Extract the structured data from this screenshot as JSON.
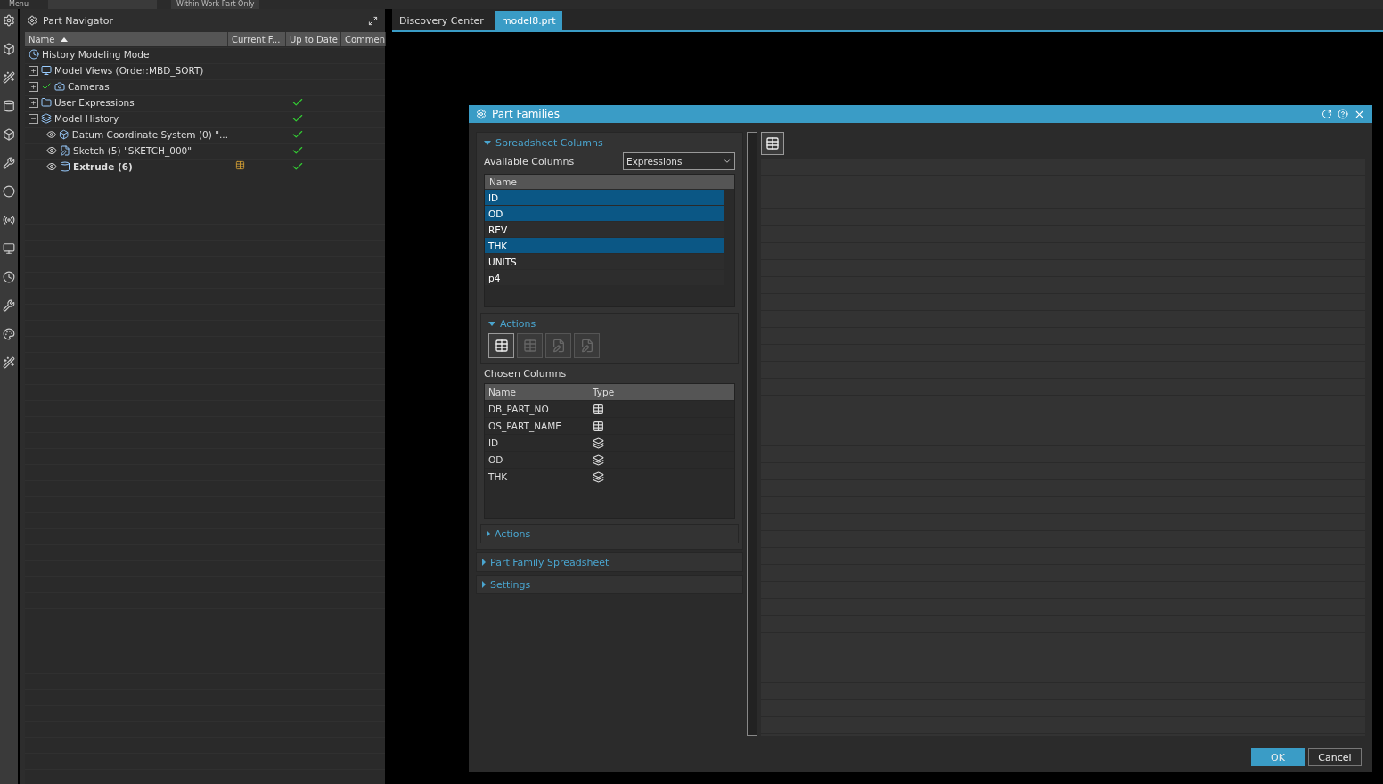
{
  "toolbar": {
    "menu": "Menu",
    "filter": "Within Work Part Only"
  },
  "navigator": {
    "title": "Part Navigator",
    "columns": [
      {
        "label": "Name",
        "sorted": true
      },
      {
        "label": "Current F..."
      },
      {
        "label": "Up to Date"
      },
      {
        "label": "Commen"
      }
    ],
    "items": [
      {
        "label": "History Modeling Mode",
        "up_to_date": false
      },
      {
        "label": "Model Views (Order:MBD_SORT)",
        "expanded": false,
        "up_to_date": false
      },
      {
        "label": "Cameras",
        "expanded": false,
        "checked": true,
        "up_to_date": false
      },
      {
        "label": "User Expressions",
        "expanded": false,
        "up_to_date": true
      },
      {
        "label": "Model History",
        "expanded": true,
        "up_to_date": true,
        "children": [
          {
            "label": "Datum Coordinate System (0) \"...",
            "up_to_date": true,
            "bold": false,
            "current": false
          },
          {
            "label": "Sketch (5) \"SKETCH_000\"",
            "up_to_date": true,
            "bold": false,
            "current": false
          },
          {
            "label": "Extrude (6)",
            "up_to_date": true,
            "bold": true,
            "current": true
          }
        ]
      }
    ]
  },
  "tabs": [
    {
      "label": "Discovery Center",
      "selected": false
    },
    {
      "label": "model8.prt",
      "selected": true
    }
  ],
  "dialog": {
    "title": "Part Families",
    "spreadsheet_columns": {
      "title": "Spreadsheet Columns",
      "expanded": true,
      "available_label": "Available Columns",
      "available_select": "Expressions",
      "list_header": "Name",
      "available": [
        {
          "name": "ID",
          "selected": true
        },
        {
          "name": "OD",
          "selected": true
        },
        {
          "name": "REV",
          "selected": false
        },
        {
          "name": "THK",
          "selected": true
        },
        {
          "name": "UNITS",
          "selected": false
        },
        {
          "name": "p4",
          "selected": false
        }
      ],
      "actions": {
        "title": "Actions",
        "expanded": true,
        "buttons": [
          {
            "kind": "add",
            "disabled": false
          },
          {
            "kind": "add",
            "disabled": true
          },
          {
            "kind": "edit",
            "disabled": true
          },
          {
            "kind": "edit",
            "disabled": true
          }
        ]
      },
      "chosen_label": "Chosen Columns",
      "chosen_columns": [
        "Name",
        "Type"
      ],
      "chosen": [
        {
          "name": "DB_PART_NO",
          "kind": "string"
        },
        {
          "name": "OS_PART_NAME",
          "kind": "string"
        },
        {
          "name": "ID",
          "kind": "number"
        },
        {
          "name": "OD",
          "kind": "number"
        },
        {
          "name": "THK",
          "kind": "number"
        }
      ],
      "actions2": {
        "title": "Actions",
        "expanded": false
      }
    },
    "sections": [
      {
        "title": "Part Family Spreadsheet",
        "expanded": false
      },
      {
        "title": "Settings",
        "expanded": false
      }
    ],
    "buttons": [
      {
        "label": "OK",
        "primary": true
      },
      {
        "label": "Cancel",
        "primary": false
      }
    ]
  }
}
